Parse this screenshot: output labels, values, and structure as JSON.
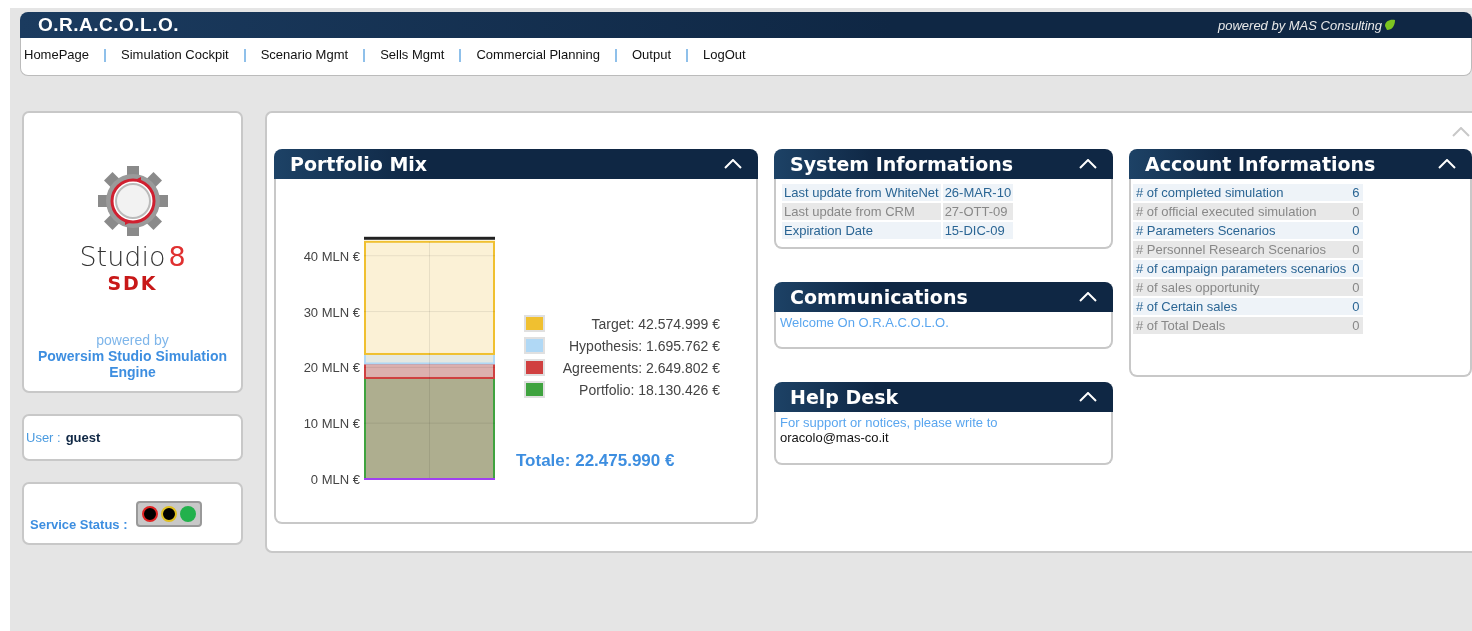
{
  "header": {
    "title": "O.R.A.C.O.L.O.",
    "powered_by": "powered by MAS Consulting"
  },
  "nav": [
    "HomePage",
    "Simulation Cockpit",
    "Scenario Mgmt",
    "Sells Mgmt",
    "Commercial Planning",
    "Output",
    "LogOut"
  ],
  "logo_card": {
    "brand": "Studio",
    "brand_number": "8",
    "product": "SDK",
    "powered_label": "powered by",
    "engine": "Powersim Studio Simulation Engine"
  },
  "user": {
    "label": "User :",
    "name": "guest"
  },
  "service_status": {
    "label": "Service Status :",
    "lights": [
      {
        "color": "#e02424",
        "on": false
      },
      {
        "color": "#e0c020",
        "on": false
      },
      {
        "color": "#22b14c",
        "on": true
      }
    ]
  },
  "portfolio_mix": {
    "title": "Portfolio Mix",
    "chart_data": {
      "type": "bar",
      "stacked": true,
      "grid": true,
      "ylim": [
        0,
        43
      ],
      "yticks": [
        {
          "value": 0,
          "label": "0 MLN €"
        },
        {
          "value": 10,
          "label": "10 MLN €"
        },
        {
          "value": 20,
          "label": "20 MLN €"
        },
        {
          "value": 30,
          "label": "30 MLN €"
        },
        {
          "value": 40,
          "label": "40 MLN €"
        }
      ],
      "series": [
        {
          "name": "Portfolio: 18.130.426 €",
          "color": "#3fa33f",
          "values": [
            18.1
          ]
        },
        {
          "name": "Agreements: 2.649.802 €",
          "color": "#d04040",
          "values": [
            2.6
          ]
        },
        {
          "name": "Hypothesis: 1.695.762 €",
          "color": "#b0d8f5",
          "values": [
            1.7
          ]
        },
        {
          "name": "Target: 42.574.999 €",
          "color": "#f0c030",
          "values": [
            20.1
          ]
        }
      ]
    },
    "total": "Totale: 22.475.990 €"
  },
  "system_informations": {
    "title": "System Informations",
    "rows": [
      [
        "Last update from WhiteNet",
        "26-MAR-10"
      ],
      [
        "Last update from CRM",
        "27-OTT-09"
      ],
      [
        "Expiration Date",
        "15-DIC-09"
      ]
    ]
  },
  "communications": {
    "title": "Communications",
    "message": "Welcome On O.R.A.C.O.L.O."
  },
  "help_desk": {
    "title": "Help Desk",
    "message": "For support or notices, please write to",
    "email": "oracolo@mas-co.it"
  },
  "account_informations": {
    "title": "Account Informations",
    "rows": [
      [
        "# of completed simulation",
        "6"
      ],
      [
        "# of official executed simulation",
        "0"
      ],
      [
        "# Parameters Scenarios",
        "0"
      ],
      [
        "# Personnel Research Scenarios",
        "0"
      ],
      [
        "# of campaign parameters scenarios",
        "0"
      ],
      [
        "# of sales opportunity",
        "0"
      ],
      [
        "# of Certain sales",
        "0"
      ],
      [
        "# of Total Deals",
        "0"
      ]
    ]
  }
}
